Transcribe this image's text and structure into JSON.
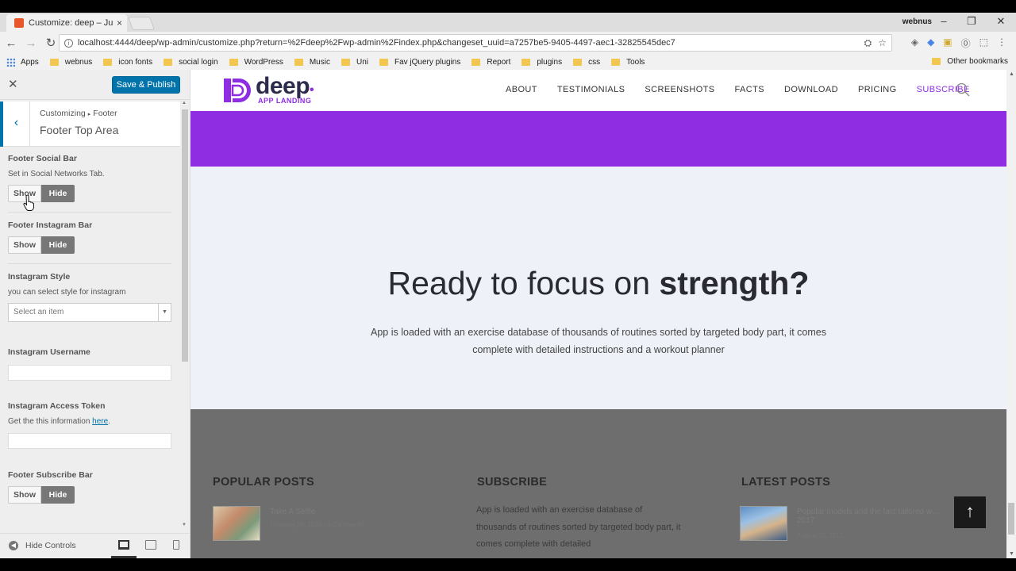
{
  "browser": {
    "tab_title": "Customize: deep – Just a",
    "tab_close": "×",
    "profile_name": "webnus",
    "win_minimize": "–",
    "win_restore": "❐",
    "win_close": "✕",
    "nav_back": "←",
    "nav_forward": "→",
    "nav_reload": "↻",
    "url": "localhost:4444/deep/wp-admin/customize.php?return=%2Fdeep%2Fwp-admin%2Findex.php&changeset_uuid=a7257be5-9405-4497-aec1-32825545dec7",
    "info_icon": "i",
    "star_icon": "☆",
    "bookmarks": [
      "Apps",
      "webnus",
      "icon fonts",
      "social login",
      "WordPress",
      "Music",
      "Uni",
      "Fav jQuery plugins",
      "Report",
      "plugins",
      "css",
      "Tools"
    ],
    "other_bookmarks": "Other bookmarks"
  },
  "panel": {
    "close_icon": "✕",
    "publish_label": "Save & Publish",
    "back_icon": "‹",
    "breadcrumb_root": "Customizing",
    "breadcrumb_sep": "▸",
    "breadcrumb_parent": "Footer",
    "section_title": "Footer Top Area",
    "controls": {
      "social_bar": {
        "title": "Footer Social Bar",
        "desc": "Set in Social Networks Tab.",
        "show": "Show",
        "hide": "Hide"
      },
      "instagram_bar": {
        "title": "Footer Instagram Bar",
        "show": "Show",
        "hide": "Hide"
      },
      "instagram_style": {
        "title": "Instagram Style",
        "desc": "you can select style for instagram",
        "select_value": "Select an item",
        "caret": "▼"
      },
      "instagram_username": {
        "title": "Instagram Username",
        "value": ""
      },
      "instagram_token": {
        "title": "Instagram Access Token",
        "desc": "Get the this information ",
        "link": "here",
        "desc_end": ".",
        "value": ""
      },
      "subscribe_bar": {
        "title": "Footer Subscribe Bar",
        "show": "Show",
        "hide": "Hide"
      }
    },
    "hide_controls": "Hide Controls",
    "hide_controls_icon": "◀",
    "scroll_up": "▲",
    "scroll_down": "▼"
  },
  "site": {
    "logo_word": "deep",
    "logo_dot": "•",
    "logo_sub": "APP LANDING",
    "nav": [
      "ABOUT",
      "TESTIMONIALS",
      "SCREENSHOTS",
      "FACTS",
      "DOWNLOAD",
      "PRICING",
      "SUBSCRIBE"
    ],
    "cta_title_plain": "Ready to focus on ",
    "cta_title_bold": "strength?",
    "cta_text": "App is loaded with an exercise database of thousands of routines sorted by targeted body part, it comes complete with detailed instructions and a workout planner",
    "footer": {
      "popular_title": "POPULAR POSTS",
      "subscribe_title": "SUBSCRIBE",
      "latest_title": "LATEST POSTS",
      "popular_post_title": "Take A Selfie",
      "popular_post_meta": "February 26, 2014 / 0 Comments",
      "subscribe_text": "App is loaded with an exercise database of thousands of routines sorted by targeted body part, it comes complete with detailed",
      "latest_post_title": "Popular models and the fact tailored w... 2017",
      "latest_post_meta": "August 22, 2017"
    },
    "to_top_icon": "↑"
  },
  "colors": {
    "accent": "#8e2de2",
    "wp_blue": "#0073aa"
  }
}
